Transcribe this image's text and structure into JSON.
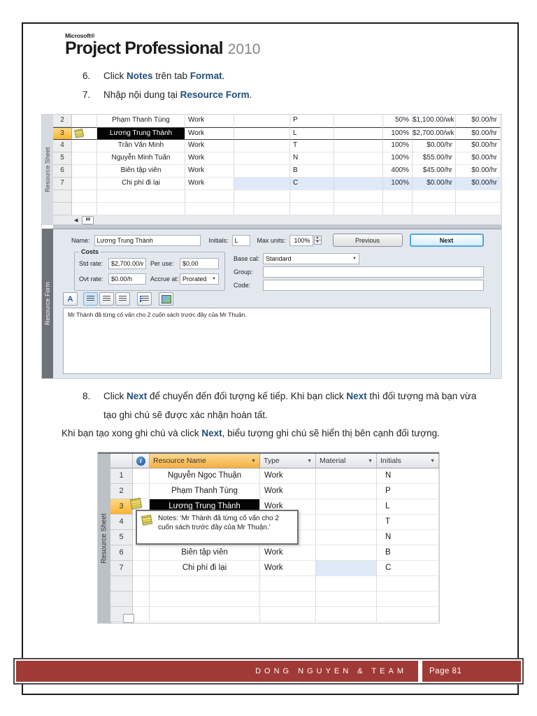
{
  "logo": {
    "microsoft": "Microsoft®",
    "product": "Project Professional",
    "year": "2010"
  },
  "colors": {
    "keyword_blue": "#1F4E79",
    "footer_red": "#A03A36",
    "selection_orange": "#FBB431",
    "cost_cell_blue": "#DEEAF8",
    "note_yellow": "#F0E45F"
  },
  "steps": {
    "s6": {
      "num": "6.",
      "parts": [
        "Click ",
        "Notes",
        " trên tab ",
        "Format",
        "."
      ]
    },
    "s7": {
      "num": "7.",
      "parts": [
        "Nhập nội dung tại ",
        "Resource Form",
        "."
      ]
    },
    "s8": {
      "num": "8.",
      "parts": [
        "Click ",
        "Next",
        " để chuyển đến đối tượng kế tiếp. Khi bạn click ",
        "Next",
        " thì đối tượng mà bạn vừa tạo ghi chú sẽ được xác nhận hoàn tất."
      ]
    }
  },
  "paragraph": {
    "parts": [
      "Khi bạn tạo xong ghi chú và click ",
      "Next",
      ", biểu tượng ghi chú sẽ hiển thị bên cạnh đối tượng."
    ]
  },
  "screenshot1": {
    "view_label_top": "Resource Sheet",
    "view_label_bottom": "Resource Form",
    "rows": [
      {
        "num": "2",
        "name": "Phạm Thanh Tùng",
        "type": "Work",
        "initials": "P",
        "max": "50%",
        "std": "$1,100.00/wk",
        "ovt": "$0.00/hr"
      },
      {
        "num": "3",
        "name": "Lương Trung Thành",
        "type": "Work",
        "initials": "L",
        "max": "100%",
        "std": "$2,700.00/wk",
        "ovt": "$0.00/hr",
        "selected": true,
        "note": true
      },
      {
        "num": "4",
        "name": "Trần Văn Minh",
        "type": "Work",
        "initials": "T",
        "max": "100%",
        "std": "$0.00/hr",
        "ovt": "$0.00/hr"
      },
      {
        "num": "5",
        "name": "Nguyễn Minh Tuấn",
        "type": "Work",
        "initials": "N",
        "max": "100%",
        "std": "$55.00/hr",
        "ovt": "$0.00/hr"
      },
      {
        "num": "6",
        "name": "Biên tập viên",
        "type": "Work",
        "initials": "B",
        "max": "400%",
        "std": "$45.00/hr",
        "ovt": "$0.00/hr"
      },
      {
        "num": "7",
        "name": "Chi phí đi lại",
        "type": "Work",
        "initials": "C",
        "max": "100%",
        "std": "$0.00/hr",
        "ovt": "$0.00/hr",
        "cost_row": true
      }
    ],
    "empty_rows": 2,
    "form": {
      "labels": {
        "name": "Name:",
        "initials": "Initials:",
        "max_units": "Max units:",
        "costs": "Costs",
        "std_rate": "Std rate:",
        "per_use": "Per use:",
        "ovt_rate": "Ovt rate:",
        "accrue_at": "Accrue at:",
        "base_cal": "Base cal:",
        "group": "Group:",
        "code": "Code:"
      },
      "values": {
        "name": "Lương Trung Thành",
        "initials": "L",
        "max_units": "100%",
        "std_rate": "$2,700.00/w",
        "per_use": "$0.00",
        "ovt_rate": "$0.00/h",
        "accrue_at": "Prorated",
        "base_cal": "Standard",
        "group": "",
        "code": ""
      },
      "buttons": {
        "previous": "Previous",
        "next": "Next"
      },
      "toolbar": {
        "font_color": "A"
      },
      "note_text": "Mr Thành đã từng cố vấn cho 2 cuốn sách trước đây của Mr Thuận."
    }
  },
  "screenshot2": {
    "view_label": "Resource Sheet",
    "headers": {
      "name": "Resource Name",
      "type": "Type",
      "material": "Material",
      "initials": "Initials"
    },
    "rows": [
      {
        "num": "1",
        "name": "Nguyễn Ngọc Thuận",
        "type": "Work",
        "material": "",
        "initials": "N"
      },
      {
        "num": "2",
        "name": "Phạm Thanh Tùng",
        "type": "Work",
        "material": "",
        "initials": "P"
      },
      {
        "num": "3",
        "name": "Lương Trung Thành",
        "type": "Work",
        "material": "",
        "initials": "L",
        "selected": true,
        "note": true
      },
      {
        "num": "4",
        "name": "",
        "type": "",
        "material": "",
        "initials": "T"
      },
      {
        "num": "5",
        "name": "",
        "type": "",
        "material": "",
        "initials": "N"
      },
      {
        "num": "6",
        "name": "Biên tập viên",
        "type": "Work",
        "material": "",
        "initials": "B"
      },
      {
        "num": "7",
        "name": "Chi phí đi lại",
        "type": "Work",
        "material": "",
        "initials": "C",
        "cost_row": true
      }
    ],
    "empty_rows": 3,
    "tooltip": "Notes: 'Mr Thành đã từng cố vấn cho 2 cuốn sách trước đây của Mr Thuận.'"
  },
  "footer": {
    "team": "DONG NGUYEN & TEAM",
    "page": "Page 81"
  }
}
